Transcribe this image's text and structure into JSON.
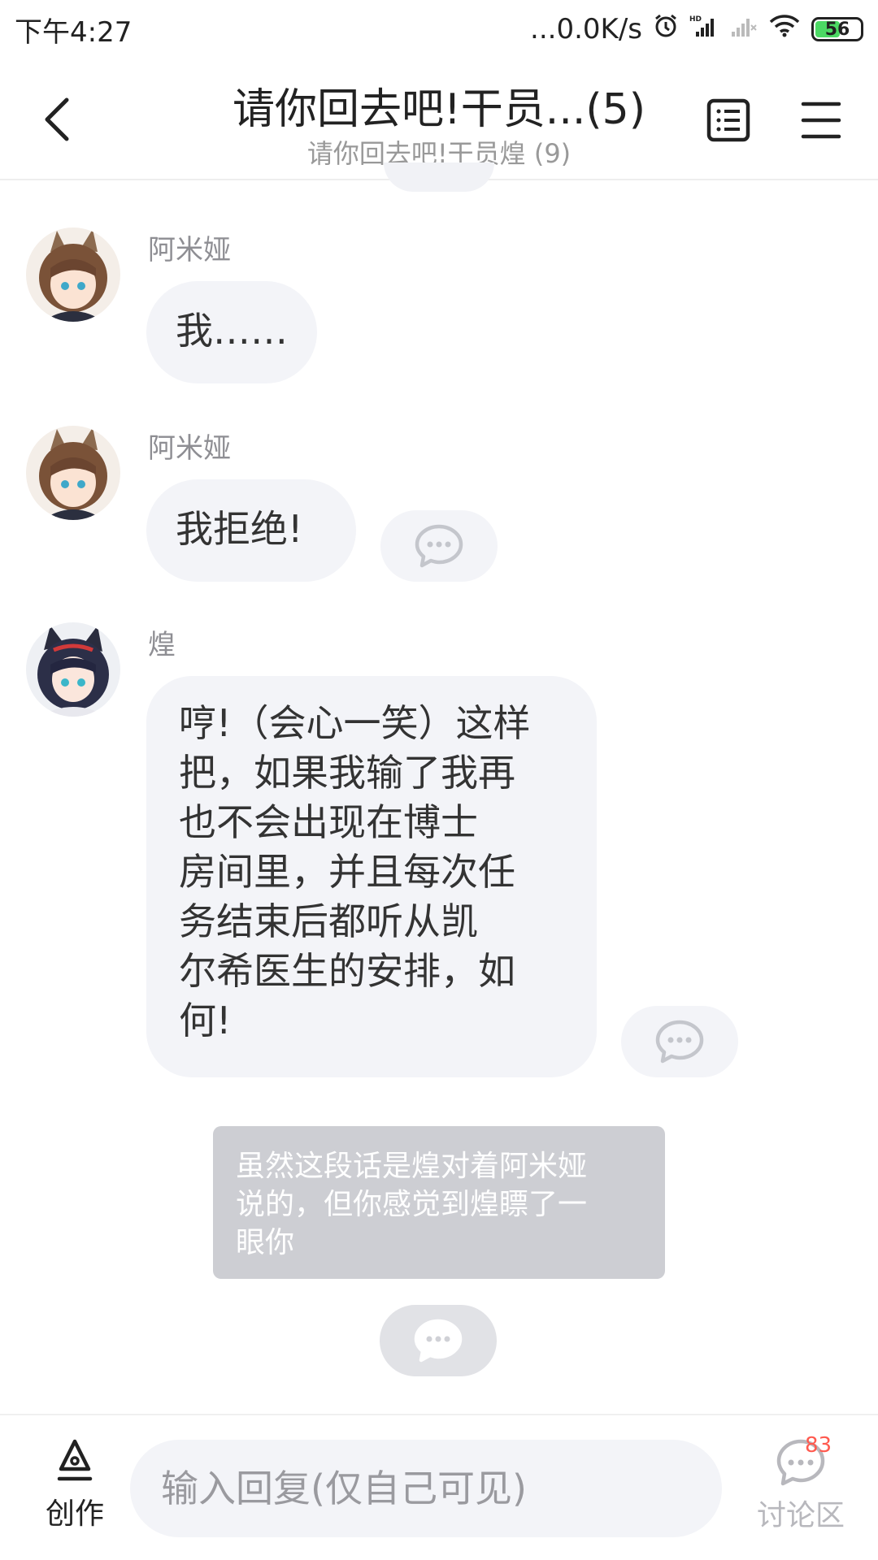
{
  "status_bar": {
    "time": "下午4:27",
    "network_speed": "...0.0K/s",
    "battery_level": "56",
    "icons": [
      "alarm-icon",
      "hd-signal-icon",
      "signal-empty-icon",
      "wifi-icon",
      "battery-icon"
    ]
  },
  "header": {
    "title": "请你回去吧!干员...(5)",
    "subtitle": "请你回去吧!干员煌 (9)",
    "icons": [
      "back-arrow-icon",
      "catalog-list-icon",
      "menu-icon"
    ]
  },
  "messages": [
    {
      "sender": "阿米娅",
      "text": "我……",
      "has_reply_button": false
    },
    {
      "sender": "阿米娅",
      "text": "我拒绝!",
      "has_reply_button": true
    },
    {
      "sender": "煌",
      "lines": [
        "哼!（会心一笑）这样",
        "把，如果我输了我再",
        "也不会出现在博士",
        "房间里，并且每次任",
        "务结束后都听从凯",
        "尔希医生的安排，如",
        "何!"
      ],
      "has_reply_button": true
    }
  ],
  "narration": {
    "lines": [
      "虽然这段话是煌对着阿米娅",
      "说的，但你感觉到煌瞟了一",
      "眼你"
    ]
  },
  "bottom_bar": {
    "create_label": "创作",
    "input_placeholder": "输入回复(仅自己可见)",
    "discussion_label": "讨论区",
    "discussion_badge": "83"
  },
  "colors": {
    "bubble_bg": "#f3f4f8",
    "narration_bg": "#cdced3",
    "badge_red": "#ff5a4f",
    "muted_text": "#8e8e93"
  }
}
